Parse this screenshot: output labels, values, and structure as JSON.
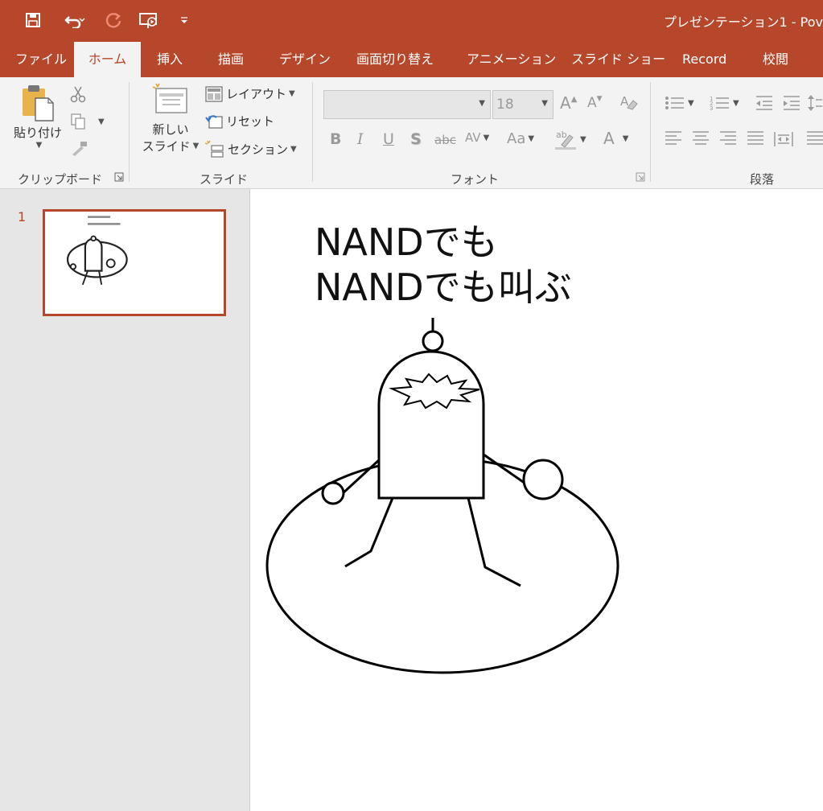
{
  "app": {
    "window_title": "プレゼンテーション1 - Pov"
  },
  "tabs": [
    {
      "label": "ファイル"
    },
    {
      "label": "ホーム"
    },
    {
      "label": "挿入"
    },
    {
      "label": "描画"
    },
    {
      "label": "デザイン"
    },
    {
      "label": "画面切り替え"
    },
    {
      "label": "アニメーション"
    },
    {
      "label": "スライド ショー"
    },
    {
      "label": "Record"
    },
    {
      "label": "校閲"
    }
  ],
  "ribbon": {
    "clipboard": {
      "paste_label_1": "貼り付け",
      "group_label": "クリップボード"
    },
    "slides": {
      "new_slide_1": "新しい",
      "new_slide_2": "スライド",
      "layout": "レイアウト",
      "reset": "リセット",
      "section": "セクション",
      "group_label": "スライド"
    },
    "font": {
      "font_size": "18",
      "group_label": "フォント",
      "bold": "B",
      "italic": "I",
      "underline": "U",
      "shadow": "S",
      "strike": "abc",
      "spacing": "AV",
      "case": "Aa",
      "grow": "A",
      "shrink": "A",
      "color": "A"
    },
    "paragraph": {
      "group_label": "段落"
    }
  },
  "thumbnails": [
    {
      "number": "1"
    }
  ],
  "slide": {
    "title_line1": "NANDでも",
    "title_line2": "NANDでも叫ぶ"
  },
  "colors": {
    "accent": "#b7472a",
    "ribbon_bg": "#f3f3f3",
    "pane_bg": "#e6e6e6"
  }
}
